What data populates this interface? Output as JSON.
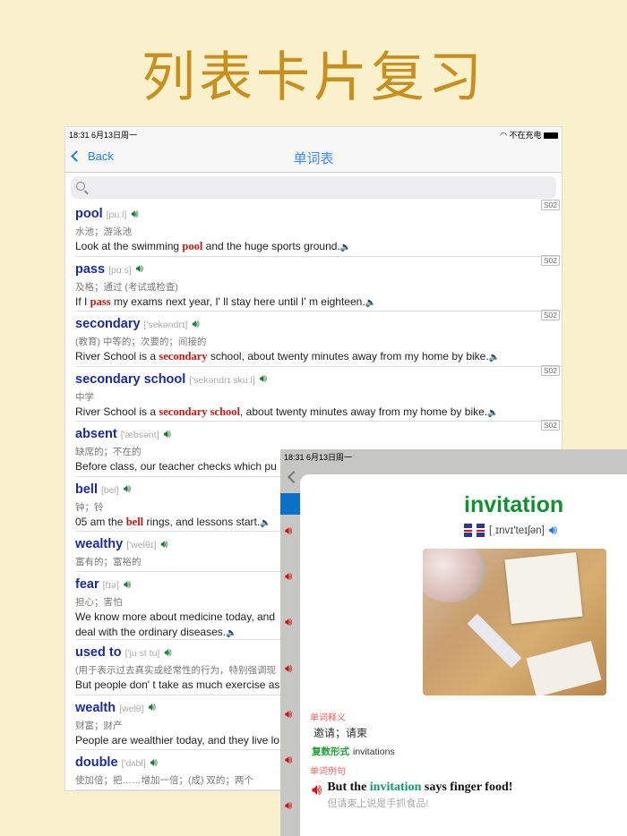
{
  "headline": "列表卡片复习",
  "status": {
    "time": "18:31  6月13日周一",
    "battery": "不在充电"
  },
  "nav": {
    "back": "Back",
    "title": "单词表"
  },
  "search": {
    "placeholder": ""
  },
  "words": [
    {
      "word": "pool",
      "ph": "[puːl]",
      "def": "水池；游泳池",
      "ex": [
        "Look at the swimming ",
        "pool",
        " and the huge sports ground."
      ],
      "tag": "S02"
    },
    {
      "word": "pass",
      "ph": "[pɑːs]",
      "def": "及格；通过 (考试或检查)",
      "ex": [
        "If I ",
        "pass",
        " my exams next year, I' ll stay here until I' m eighteen."
      ],
      "tag": "S02"
    },
    {
      "word": "secondary",
      "ph": "['sekəndrɪ]",
      "def": "(教育) 中等的；次要的；间接的",
      "ex": [
        "River School is a ",
        "secondary",
        " school, about twenty minutes away from my home by bike."
      ],
      "tag": "S02"
    },
    {
      "word": "secondary school",
      "ph": "['sekəndrɪ skuːl]",
      "def": "中学",
      "ex": [
        "River School is a ",
        "secondary school",
        ", about twenty minutes away from my home by bike."
      ],
      "tag": "S02"
    },
    {
      "word": "absent",
      "ph": "['æbsənt]",
      "def": "缺席的；不在的",
      "ex": [
        "Before class, our teacher checks which pu",
        "",
        ""
      ],
      "tag": "S02"
    },
    {
      "word": "bell",
      "ph": "[bel]",
      "def": "钟；铃",
      "ex": [
        "05 am the ",
        "bell",
        " rings, and lessons start."
      ]
    },
    {
      "word": "wealthy",
      "ph": "['welθɪ]",
      "def": "富有的；富裕的"
    },
    {
      "word": "fear",
      "ph": "[fɪə]",
      "def": "担心；害怕",
      "ex": [
        "We know more about medicine today, and",
        "",
        ""
      ],
      "ex2": "deal with the ordinary diseases."
    },
    {
      "word": "used to",
      "ph": "['juːst tu]",
      "def": "(用于表示过去真实或经常性的行为，特别强调现",
      "ex": [
        "But people don' t take as much exercise as",
        "",
        ""
      ]
    },
    {
      "word": "wealth",
      "ph": "[welθ]",
      "def": "财富；财产",
      "ex": [
        "People are wealthier today, and they live lo",
        "",
        ""
      ]
    },
    {
      "word": "double",
      "ph": "['dʌbl]",
      "def": "使加倍；把……增加一倍；(成) 双的；两个"
    }
  ],
  "card": {
    "status": "18:31  6月13日周一",
    "word": "invitation",
    "ph": "[ˌɪnvɪ'teɪʃən]",
    "meaning_label": "单词释义",
    "meaning": "邀请；请柬",
    "plural_label": "复数形式",
    "plural": "invitations",
    "example_label": "单词例句",
    "example": [
      "But the ",
      "invitation",
      " says finger food!"
    ],
    "example_cn": "但请柬上说是手抓食品!"
  }
}
